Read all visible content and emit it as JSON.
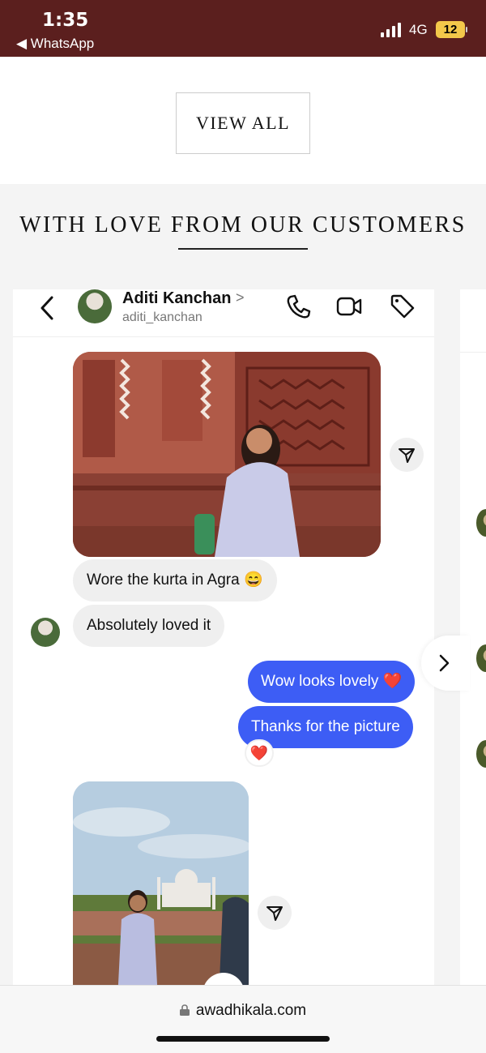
{
  "status_bar": {
    "time": "1:35",
    "back_app": "◀ WhatsApp",
    "network": "4G",
    "battery": "12"
  },
  "page": {
    "view_all_label": "VIEW ALL",
    "section_title": "WITH LOVE FROM OUR CUSTOMERS"
  },
  "chat": {
    "name": "Aditi Kanchan",
    "handle": "aditi_kanchan",
    "messages_in": [
      "Wore the kurta in Agra 😄",
      "Absolutely loved it"
    ],
    "messages_out": [
      "Wow looks lovely ❤️",
      "Thanks for the picture"
    ],
    "reaction": "❤️"
  },
  "browser": {
    "url": "awadhikala.com"
  },
  "colors": {
    "status_bar": "#5b1f1e",
    "outgoing_bubble": "#3d5df5",
    "incoming_bubble": "#efefef"
  }
}
